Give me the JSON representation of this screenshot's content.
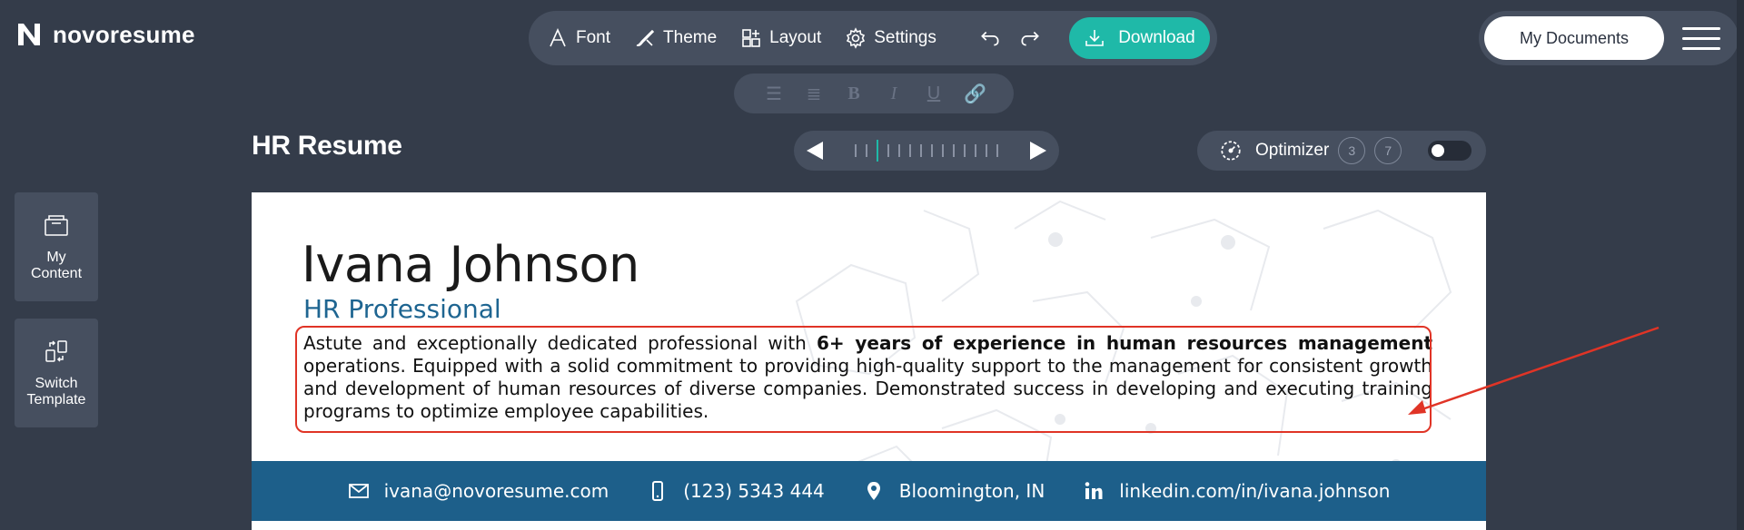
{
  "brand": {
    "name": "novoresume"
  },
  "toolbar": {
    "font_label": "Font",
    "theme_label": "Theme",
    "layout_label": "Layout",
    "settings_label": "Settings",
    "download_label": "Download"
  },
  "header_right": {
    "my_documents_label": "My Documents"
  },
  "page": {
    "title": "HR Resume"
  },
  "pager": {
    "total_pages": 14,
    "current_page": 3
  },
  "optimizer": {
    "label": "Optimizer",
    "badge_1": "3",
    "badge_2": "7",
    "enabled": false
  },
  "sidebar": {
    "my_content_label": "My Content",
    "switch_template_label": "Switch Template"
  },
  "resume": {
    "name": "Ivana Johnson",
    "role": "HR Professional",
    "summary_before": "Astute and exceptionally dedicated professional with ",
    "summary_bold": "6+ years of experience in human resources management",
    "summary_after": " operations. Equipped with a solid commitment to providing high-quality support to the management for consistent growth and development of human resources of diverse companies. Demonstrated success in developing and executing training programs to optimize employee capabilities.",
    "contact": {
      "email": "ivana@novoresume.com",
      "phone": "(123) 5343 444",
      "location": "Bloomington, IN",
      "linkedin": "linkedin.com/in/ivana.johnson"
    }
  },
  "colors": {
    "background": "#343c4a",
    "panel": "#464f5f",
    "accent": "#1fb9a8",
    "resume_blue": "#1d5f8a",
    "annotation_red": "#e03426"
  }
}
